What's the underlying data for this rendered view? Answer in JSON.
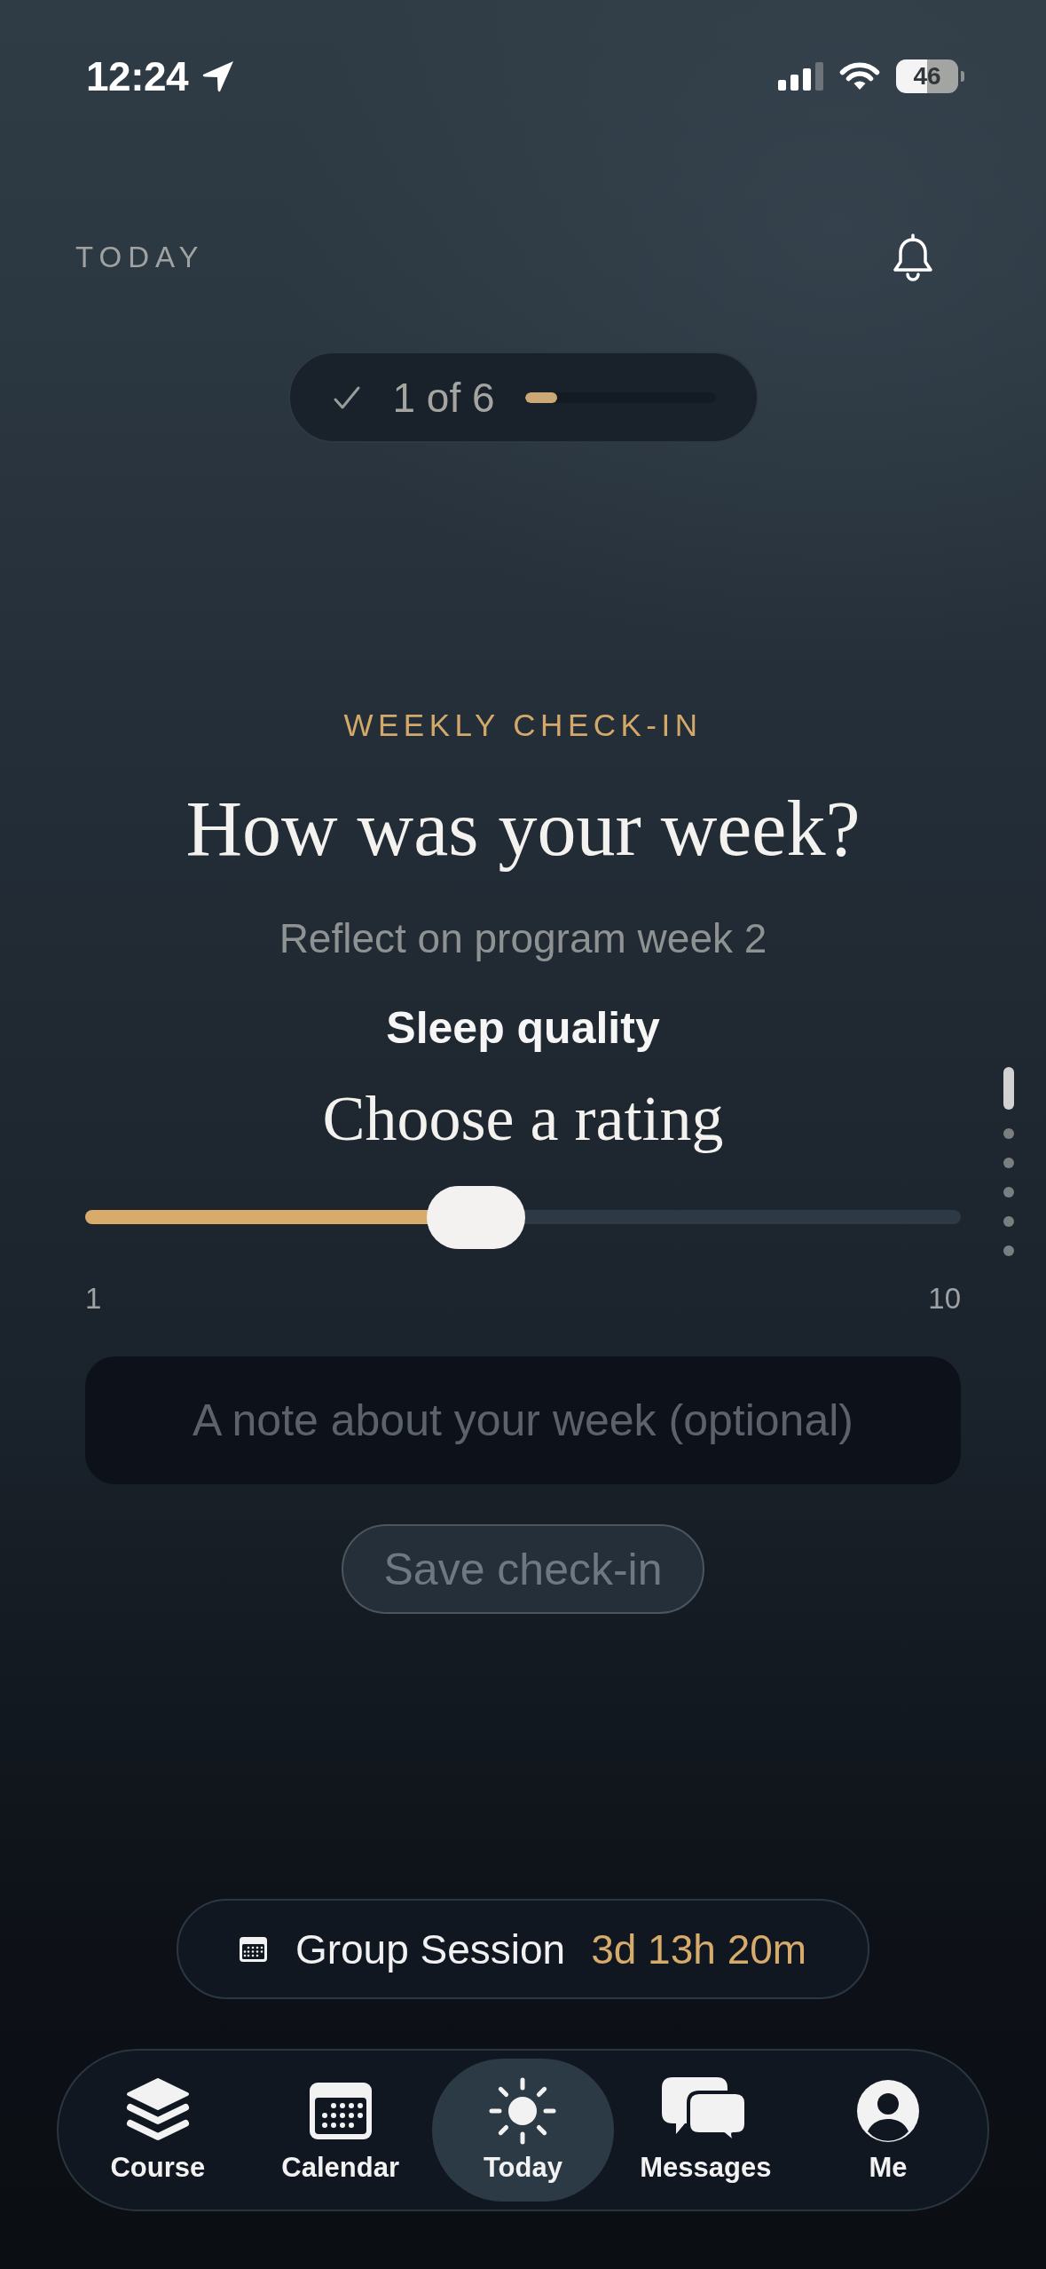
{
  "status_bar": {
    "time": "12:24",
    "battery": "46"
  },
  "header": {
    "title": "TODAY"
  },
  "progress": {
    "label": "1 of 6",
    "level": 0.17
  },
  "checkin": {
    "eyebrow": "WEEKLY CHECK-IN",
    "title": "How was your week?",
    "subtitle": "Reflect on program week 2",
    "question": "Sleep quality",
    "prompt": "Choose a rating",
    "slider": {
      "level": 0.44,
      "min_label": "1",
      "max_label": "10"
    },
    "note": {
      "placeholder": "A note about your week (optional)"
    },
    "save_button": {
      "label": "Save check-in",
      "disabled": true
    }
  },
  "page_dots": [
    {
      "selected": true
    },
    {
      "selected": false
    },
    {
      "selected": false
    },
    {
      "selected": false
    },
    {
      "selected": false
    },
    {
      "selected": false
    }
  ],
  "session": {
    "label": "Group Session",
    "countdown": "3d 13h 20m"
  },
  "tabs": [
    {
      "label": "Course",
      "selected": false
    },
    {
      "label": "Calendar",
      "selected": false
    },
    {
      "label": "Today",
      "selected": true
    },
    {
      "label": "Messages",
      "selected": false
    },
    {
      "label": "Me",
      "selected": false
    }
  ]
}
